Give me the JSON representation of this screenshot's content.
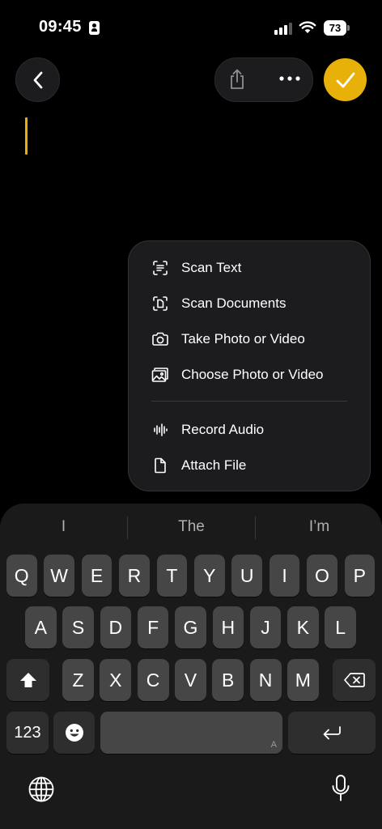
{
  "status_bar": {
    "time": "09:45",
    "battery": "73"
  },
  "nav": {
    "back_icon": "chevron-left-icon",
    "share_icon": "share-icon",
    "more_icon": "ellipsis-icon",
    "done_icon": "checkmark-icon",
    "accent": "#e8b10a"
  },
  "attach_menu": {
    "items": [
      {
        "label": "Scan Text",
        "icon": "scan-text-icon"
      },
      {
        "label": "Scan Documents",
        "icon": "scan-documents-icon"
      },
      {
        "label": "Take Photo or Video",
        "icon": "camera-icon"
      },
      {
        "label": "Choose Photo or Video",
        "icon": "photo-library-icon"
      },
      {
        "label": "Record Audio",
        "icon": "waveform-icon"
      },
      {
        "label": "Attach File",
        "icon": "document-icon"
      }
    ]
  },
  "keyboard": {
    "suggestions": [
      "I",
      "The",
      "I’m"
    ],
    "row1": [
      "Q",
      "W",
      "E",
      "R",
      "T",
      "Y",
      "U",
      "I",
      "O",
      "P"
    ],
    "row2": [
      "A",
      "S",
      "D",
      "F",
      "G",
      "H",
      "J",
      "K",
      "L"
    ],
    "row3": [
      "Z",
      "X",
      "C",
      "V",
      "B",
      "N",
      "M"
    ],
    "numbers_key": "123",
    "space_hint": "A"
  }
}
